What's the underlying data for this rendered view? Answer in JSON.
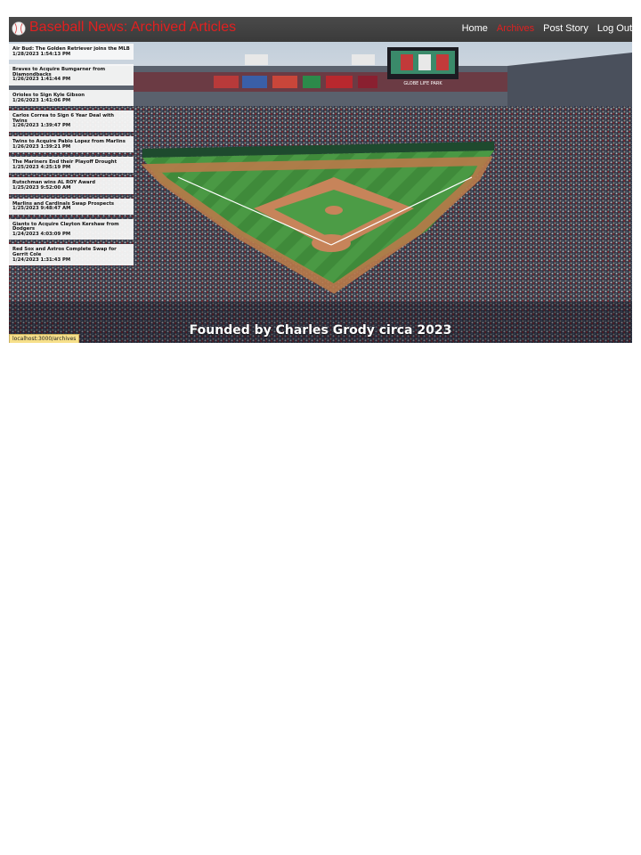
{
  "app": {
    "title": "Baseball News: Archived Articles",
    "logo_icon": "baseball-icon",
    "accent_color": "#e02020"
  },
  "nav": {
    "items": [
      {
        "label": "Home",
        "active": false
      },
      {
        "label": "Archives",
        "active": true
      },
      {
        "label": "Post Story",
        "active": false
      },
      {
        "label": "Log Out",
        "active": false
      }
    ]
  },
  "articles": [
    {
      "title": "Air Bud: The Golden Retriever joins the MLB",
      "date": "1/28/2023 1:54:13 PM"
    },
    {
      "title": "Braves to Acquire Bumgarner from Diamondbacks",
      "date": "1/26/2023 1:41:44 PM"
    },
    {
      "title": "Orioles to Sign Kyle Gibson",
      "date": "1/26/2023 1:41:06 PM"
    },
    {
      "title": "Carlos Correa to Sign 6 Year Deal with Twins",
      "date": "1/26/2023 1:39:47 PM"
    },
    {
      "title": "Twins to Acquire Pablo Lopez from Marlins",
      "date": "1/26/2023 1:39:21 PM"
    },
    {
      "title": "The Mariners End their Playoff Drought",
      "date": "1/25/2023 4:25:19 PM"
    },
    {
      "title": "Rutschman wins AL ROY Award",
      "date": "1/25/2023 9:52:00 AM"
    },
    {
      "title": "Marlins and Cardinals Swap Prospects",
      "date": "1/25/2023 9:48:47 AM"
    },
    {
      "title": "Giants to Acquire Clayton Kershaw from Dodgers",
      "date": "1/24/2023 4:03:09 PM"
    },
    {
      "title": "Red Sox and Astros Complete Swap for Gerrit Cole",
      "date": "1/24/2023 1:31:43 PM"
    }
  ],
  "footer": {
    "text": "Founded by Charles Grody circa 2023"
  },
  "statusbar": {
    "url": "localhost:3000/archives"
  },
  "scoreboard": {
    "label": "GLOBE LIFE PARK"
  }
}
